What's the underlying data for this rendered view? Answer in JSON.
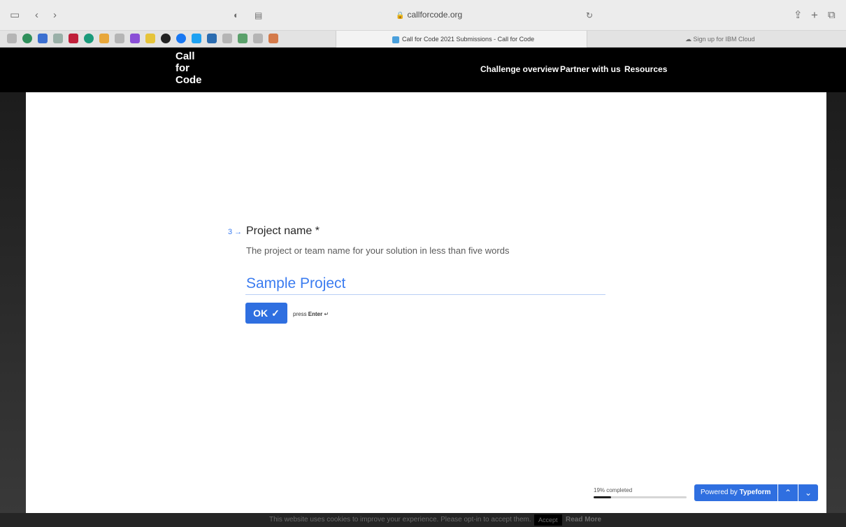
{
  "browser": {
    "url": "callforcode.org",
    "tabs": [
      {
        "label": "Call for Code 2021 Submissions - Call for Code",
        "active": true
      },
      {
        "label": "Sign up for IBM Cloud",
        "active": false
      }
    ]
  },
  "header": {
    "logo": [
      "Call",
      "for",
      "Code"
    ],
    "nav": [
      "Challenge overview",
      "Partner with us",
      "Resources"
    ]
  },
  "question": {
    "number": "3",
    "title": "Project name *",
    "description": "The project or team name for your solution in less than five words",
    "answer": "Sample Project",
    "ok_label": "OK",
    "hint_prefix": "press",
    "hint_key": "Enter"
  },
  "progress": {
    "label": "19% completed",
    "fraction": 0.19
  },
  "footer": {
    "powered_prefix": "Powered by",
    "powered_brand": "Typeform"
  },
  "cookie": {
    "text": "This website uses cookies to improve your experience. Please opt-in to accept them.",
    "accept_label": "Accept",
    "more_label": "Read More"
  },
  "colors": {
    "accent": "#2f6fe0",
    "answer_text": "#3b7cf0"
  }
}
